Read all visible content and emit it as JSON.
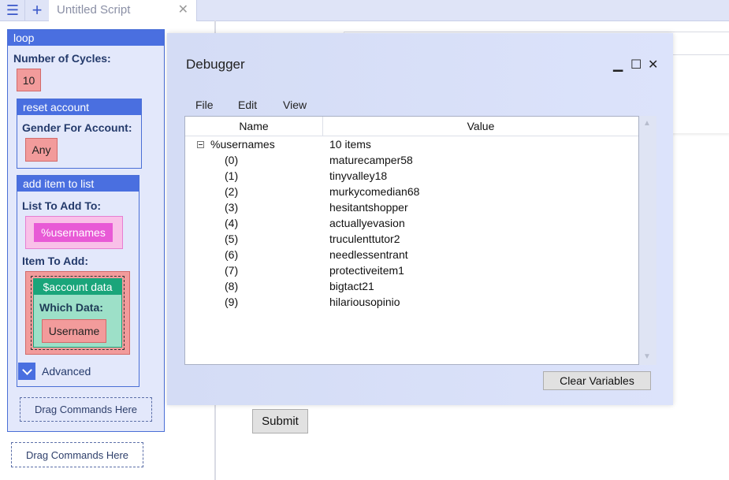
{
  "tabbar": {
    "tab_title": "Untitled Script",
    "menu_icon": "☰",
    "plus_icon": "+",
    "close_icon": "✕"
  },
  "script": {
    "loop": {
      "title": "loop",
      "cycles_label": "Number of Cycles:",
      "cycles_value": "10"
    },
    "reset_account": {
      "title": "reset account",
      "gender_label": "Gender For Account:",
      "gender_value": "Any"
    },
    "add_item": {
      "title": "add item to list",
      "list_label": "List To Add To:",
      "list_value": "%usernames",
      "item_label": "Item To Add:",
      "account_data_title": "$account data",
      "which_data_label": "Which Data:",
      "which_data_value": "Username",
      "advanced_label": "Advanced"
    },
    "inner_drag": "Drag Commands Here",
    "outer_drag": "Drag Commands Here"
  },
  "debugger": {
    "title": "Debugger",
    "window_buttons": {
      "minimize": "▁",
      "maximize": "☐",
      "close": "✕"
    },
    "menu": [
      "File",
      "Edit",
      "View"
    ],
    "columns": {
      "name": "Name",
      "value": "Value"
    },
    "root": {
      "name": "%usernames",
      "value": "10 items"
    },
    "items": [
      {
        "name": "(0)",
        "value": "maturecamper58"
      },
      {
        "name": "(1)",
        "value": "tinyvalley18"
      },
      {
        "name": "(2)",
        "value": "murkycomedian68"
      },
      {
        "name": "(3)",
        "value": "hesitantshopper"
      },
      {
        "name": "(4)",
        "value": "actuallyevasion"
      },
      {
        "name": "(5)",
        "value": "truculenttutor2"
      },
      {
        "name": "(6)",
        "value": "needlessentrant"
      },
      {
        "name": "(7)",
        "value": "protectiveitem1"
      },
      {
        "name": "(8)",
        "value": "bigtact21"
      },
      {
        "name": "(9)",
        "value": "hilariousopinio"
      }
    ],
    "clear_button": "Clear Variables"
  },
  "form": {
    "submit_button": "Submit"
  },
  "colors": {
    "block_header": "#4a6fe0",
    "variable_pill": "#e85ad6",
    "value_pill": "#f29b9b",
    "account_data": "#1aa57a"
  }
}
